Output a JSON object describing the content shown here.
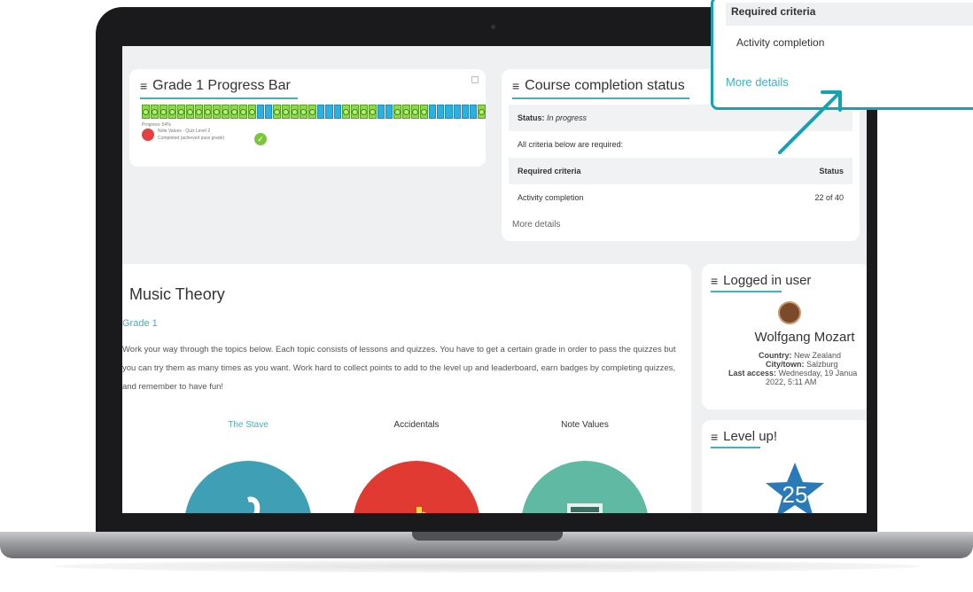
{
  "grade_card": {
    "title": "Grade 1 Progress Bar",
    "progress_text": "Progress: 54%",
    "progress_fraction": 0.54,
    "quiz_title": "Note Values - Quiz Level 2",
    "quiz_status": "Completed (achieved pass grade)"
  },
  "completion": {
    "title": "Course completion status",
    "status_label": "Status:",
    "status_value": "In progress",
    "criteria_note": "All criteria below are required:",
    "col_criteria": "Required criteria",
    "col_status": "Status",
    "activity_label": "Activity completion",
    "activity_value": "22 of 40",
    "more_details": "More details"
  },
  "course": {
    "title": "Music Theory",
    "grade_link": "Grade 1",
    "description": "Work your way through the topics below. Each topic consists of lessons and quizzes. You have to get a certain grade in order to pass the quizzes but you can try them as many times as you want. Work hard to collect points to add to the level up and leaderboard, earn badges by completing quizzes, and remember to have fun!",
    "topics": [
      "The Stave",
      "Accidentals",
      "Note Values"
    ]
  },
  "user_card": {
    "title": "Logged in user",
    "name": "Wolfgang Mozart",
    "country_label": "Country:",
    "country": "New Zealand",
    "city_label": "City/town:",
    "city": "Salzburg",
    "last_access_label": "Last access:",
    "last_access_line1": "Wednesday, 19 Janua",
    "last_access_line2": "2022, 5:11 AM"
  },
  "level_card": {
    "title": "Level up!",
    "level": "25"
  },
  "popup": {
    "header": "Required criteria",
    "activity": "Activity completion",
    "more_details": "More details"
  },
  "colors": {
    "accent": "#3fb1c1",
    "popup_border": "#14a3b3",
    "stave": "#3f9fb4",
    "accidentals": "#e03a33",
    "note_values": "#5fb9a3"
  }
}
